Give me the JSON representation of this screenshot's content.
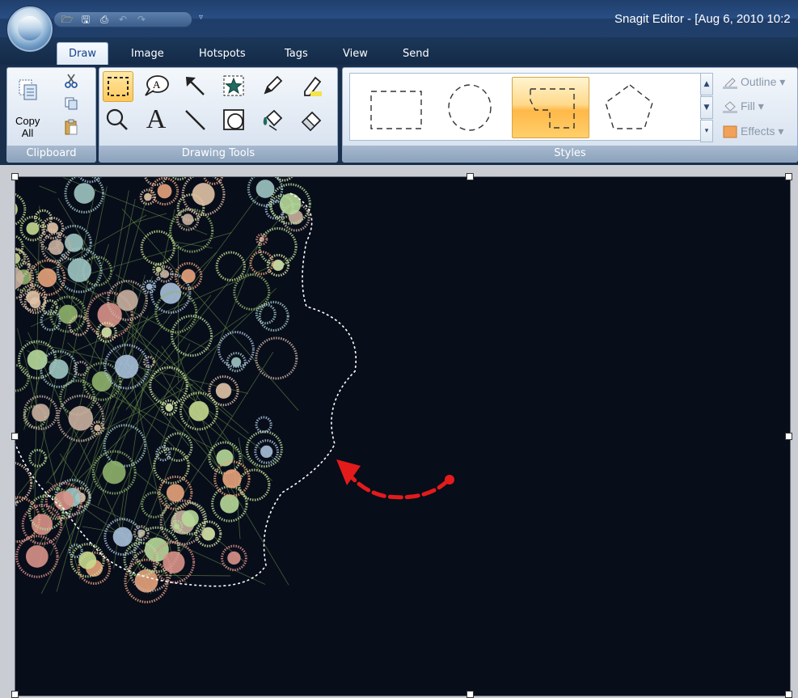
{
  "window": {
    "title": "Snagit Editor - [Aug 6, 2010 10:2"
  },
  "quick_access": {
    "items": [
      {
        "icon": "open-folder-icon",
        "glyph": "🗁"
      },
      {
        "icon": "save-icon",
        "glyph": "🖫"
      },
      {
        "icon": "print-icon",
        "glyph": "⎙"
      },
      {
        "icon": "undo-icon",
        "glyph": "↶"
      },
      {
        "icon": "redo-icon",
        "glyph": "↷"
      }
    ],
    "more_glyph": "▿"
  },
  "tabs": [
    "Draw",
    "Image",
    "Hotspots",
    "Tags",
    "View",
    "Send"
  ],
  "active_tab": "Draw",
  "ribbon": {
    "clipboard": {
      "label": "Clipboard",
      "copy_all_line1": "Copy",
      "copy_all_line2": "All",
      "icons": [
        "copy-all-icon",
        "cut-icon",
        "copy-icon",
        "paste-icon"
      ]
    },
    "drawing_tools": {
      "label": "Drawing Tools",
      "selected": "selection-tool",
      "tools_row1": [
        "selection-tool-icon",
        "callout-tool-icon",
        "arrow-tool-icon",
        "stamp-tool-icon",
        "pen-tool-icon",
        "highlight-tool-icon"
      ],
      "tools_row2": [
        "zoom-tool-icon",
        "text-tool-icon",
        "line-tool-icon",
        "shape-tool-icon",
        "fill-tool-icon",
        "erase-tool-icon"
      ],
      "text_glyph": "A"
    },
    "styles": {
      "label": "Styles",
      "options": [
        "Outline",
        "Fill",
        "Effects"
      ],
      "selected_index": 2
    }
  },
  "colors": {
    "accent_orange": "#ffb848",
    "canvas_bg": "#080d1a",
    "arrow_red": "#e31b1b"
  }
}
